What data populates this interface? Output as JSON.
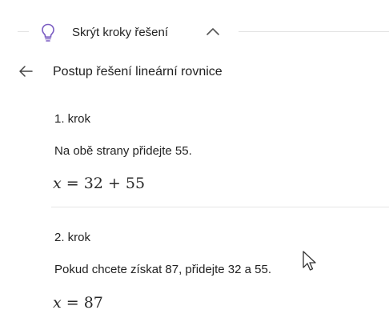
{
  "toggle": {
    "label": "Skrýt kroky řešení",
    "icon": "lightbulb-icon",
    "chevron": "chevron-up-icon",
    "accent_color": "#7a5cc2"
  },
  "header": {
    "back_icon": "back-arrow-icon",
    "title": "Postup řešení lineární rovnice"
  },
  "steps": [
    {
      "label": "1. krok",
      "text": "Na obě strany přidejte 55.",
      "math_var": "x",
      "math_rest": " = 32 + 55"
    },
    {
      "label": "2. krok",
      "text": "Pokud chcete získat 87, přidejte 32 a 55.",
      "math_var": "x",
      "math_rest": " = 87"
    }
  ]
}
